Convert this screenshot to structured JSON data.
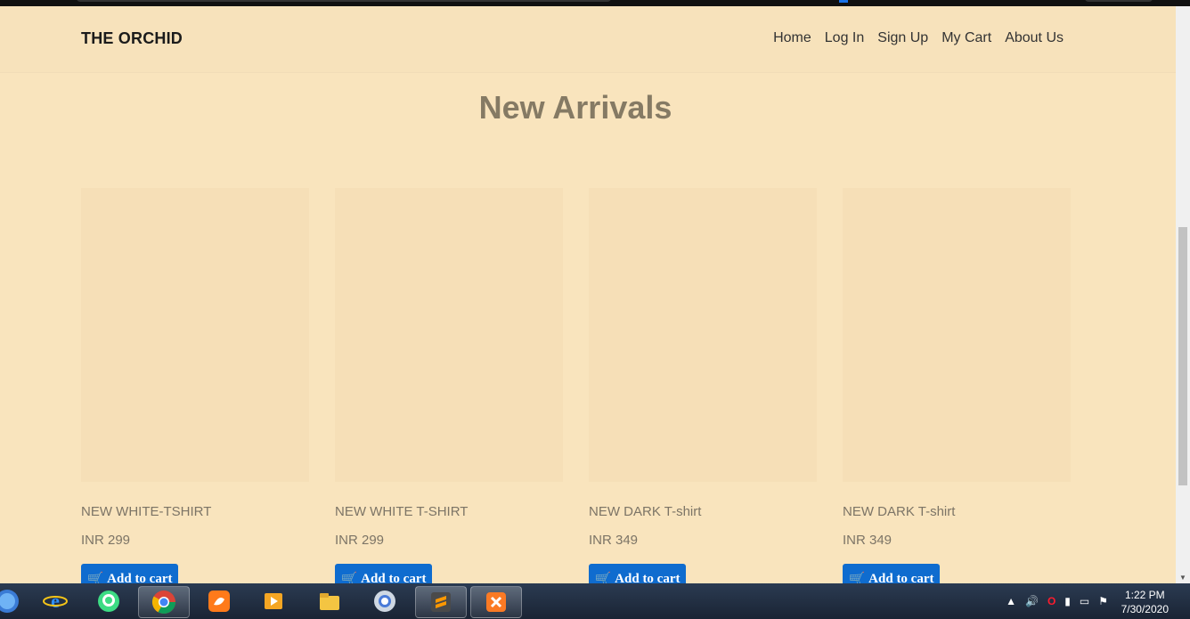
{
  "navbar": {
    "brand": "THE ORCHID",
    "links": [
      "Home",
      "Log In",
      "Sign Up",
      "My Cart",
      "About Us"
    ]
  },
  "section": {
    "title": "New Arrivals"
  },
  "products": [
    {
      "name": "NEW WHITE-TSHIRT",
      "price": "INR 299",
      "button": "Add to cart"
    },
    {
      "name": "NEW WHITE T-SHIRT",
      "price": "INR 299",
      "button": "Add to cart"
    },
    {
      "name": "NEW DARK T-shirt",
      "price": "INR 349",
      "button": "Add to cart"
    },
    {
      "name": "NEW DARK T-shirt",
      "price": "INR 349",
      "button": "Add to cart"
    }
  ],
  "taskbar": {
    "clock_time": "1:22 PM",
    "clock_date": "7/30/2020",
    "apps": [
      "ie-icon",
      "android-studio-icon",
      "chrome-icon",
      "uc-browser-icon",
      "media-player-icon",
      "file-explorer-icon",
      "chrome-canary-icon",
      "sublime-text-icon",
      "xampp-icon"
    ]
  },
  "colors": {
    "page_bg": "#f9e4bd",
    "button_bg": "#0f6ccf",
    "title": "#857a64"
  }
}
